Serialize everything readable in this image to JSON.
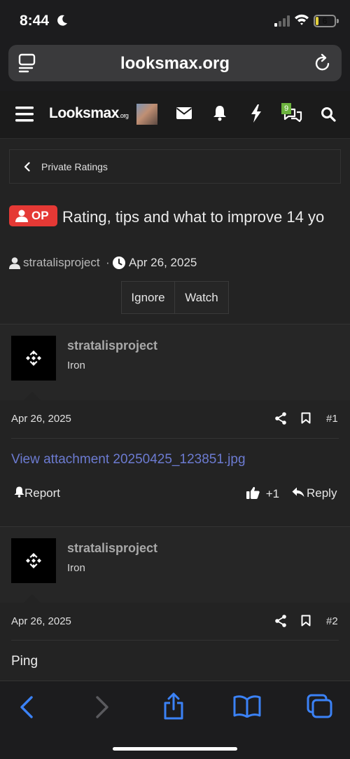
{
  "status_bar": {
    "time": "8:44",
    "battery_level": "6",
    "icons": [
      "moon-icon",
      "signal-icon",
      "wifi-icon",
      "battery-icon"
    ]
  },
  "browser": {
    "url": "looksmax.org",
    "icons": [
      "reader-icon",
      "reload-icon"
    ]
  },
  "site_nav": {
    "logo_main": "Looksmax",
    "logo_suffix": ".org",
    "alert_count": "9",
    "icons": [
      "menu-icon",
      "avatar",
      "mail-icon",
      "bell-icon",
      "bolt-icon",
      "chat-icon",
      "search-icon"
    ]
  },
  "breadcrumb": {
    "label": "Private Ratings"
  },
  "thread": {
    "op_badge": "OP",
    "title": "Rating, tips and what to improve 14 yo",
    "author": "stratalisproject",
    "separator": "·",
    "date": "Apr 26, 2025",
    "buttons": [
      "Ignore",
      "Watch"
    ]
  },
  "posts": [
    {
      "username": "stratalisproject",
      "rank": "Iron",
      "date": "Apr 26, 2025",
      "number": "#1",
      "attachment": "View attachment 20250425_123851.jpg",
      "report_label": "Report",
      "reaction": "+1",
      "reply_label": "Reply"
    },
    {
      "username": "stratalisproject",
      "rank": "Iron",
      "date": "Apr 26, 2025",
      "number": "#2",
      "body": "Ping"
    }
  ],
  "toolbar": {
    "icons": [
      "back-icon",
      "forward-icon",
      "share-icon",
      "bookmarks-icon",
      "tabs-icon"
    ]
  },
  "colors": {
    "accent": "#3b82f6",
    "op_badge": "#e53935",
    "link": "#6c7bd1",
    "background": "#232323"
  }
}
